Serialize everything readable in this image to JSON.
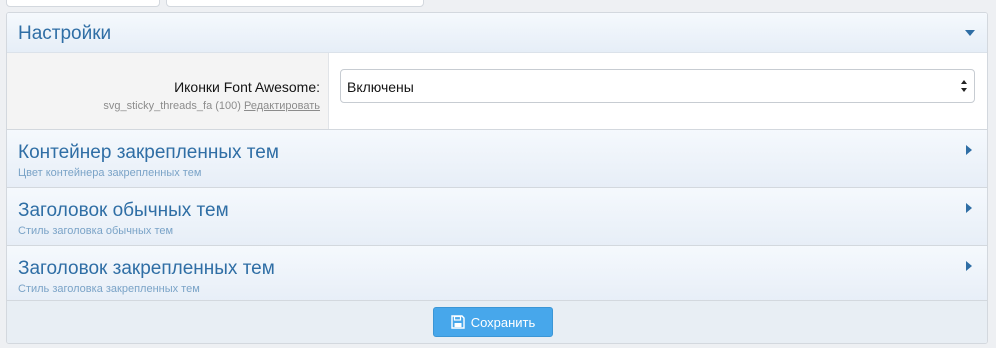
{
  "settings": {
    "title": "Настройки",
    "option": {
      "label": "Иконки Font Awesome:",
      "hint": "svg_sticky_threads_fa (100)",
      "edit_link": "Редактировать",
      "value": "Включены"
    }
  },
  "groups": [
    {
      "title": "Контейнер закрепленных тем",
      "desc": "Цвет контейнера закрепленных тем"
    },
    {
      "title": "Заголовок обычных тем",
      "desc": "Стиль заголовка обычных тем"
    },
    {
      "title": "Заголовок закрепленных тем",
      "desc": "Стиль заголовка закрепленных тем"
    }
  ],
  "footer": {
    "save_label": "Сохранить"
  },
  "icons": {
    "collapse": "chevron-down-icon",
    "expand": "chevron-right-icon",
    "save": "floppy-disk-icon"
  },
  "colors": {
    "accent": "#2f6ea5",
    "button": "#47a7eb"
  }
}
